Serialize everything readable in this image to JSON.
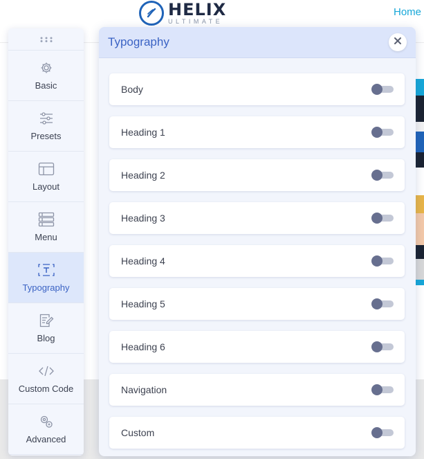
{
  "site": {
    "logo_main": "HELIX",
    "logo_sub": "ULTIMATE",
    "nav_home": "Home",
    "hero_strip_colors": [
      "#16a7d8",
      "#1a2230",
      "#f2f2f2",
      "#1f63b8",
      "#1a2230",
      "#ffffff",
      "#e9b547",
      "#f4c9a8",
      "#1a2230",
      "#d8d8d8",
      "#16a7d8"
    ]
  },
  "sidebar": {
    "items": [
      {
        "label": "Basic",
        "icon": "gear-icon",
        "active": false
      },
      {
        "label": "Presets",
        "icon": "sliders-icon",
        "active": false
      },
      {
        "label": "Layout",
        "icon": "layout-icon",
        "active": false
      },
      {
        "label": "Menu",
        "icon": "menu-list-icon",
        "active": false
      },
      {
        "label": "Typography",
        "icon": "typography-icon",
        "active": true
      },
      {
        "label": "Blog",
        "icon": "blog-edit-icon",
        "active": false
      },
      {
        "label": "Custom Code",
        "icon": "code-icon",
        "active": false
      },
      {
        "label": "Advanced",
        "icon": "advanced-settings-icon",
        "active": false
      }
    ]
  },
  "panel": {
    "title": "Typography",
    "rows": [
      {
        "label": "Body",
        "enabled": false
      },
      {
        "label": "Heading 1",
        "enabled": false
      },
      {
        "label": "Heading 2",
        "enabled": false
      },
      {
        "label": "Heading 3",
        "enabled": false
      },
      {
        "label": "Heading 4",
        "enabled": false
      },
      {
        "label": "Heading 5",
        "enabled": false
      },
      {
        "label": "Heading 6",
        "enabled": false
      },
      {
        "label": "Navigation",
        "enabled": false
      },
      {
        "label": "Custom",
        "enabled": false
      }
    ]
  },
  "colors": {
    "accent": "#3b63c4",
    "active_bg": "#dde7fb",
    "toggle_knob": "#676f8f",
    "toggle_track": "#c3c8d6"
  }
}
